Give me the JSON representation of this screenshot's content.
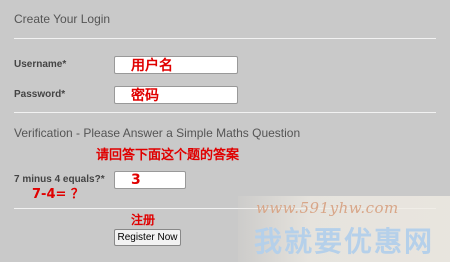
{
  "form": {
    "title": "Create Your Login",
    "username_label": "Username*",
    "password_label": "Password*",
    "verification_title": "Verification - Please Answer a Simple Maths Question",
    "question_label": "7 minus 4 equals?*",
    "register_label": "Register Now"
  },
  "fields": {
    "username_value": "用户名",
    "password_value": "密码",
    "answer_value": "3"
  },
  "annotations": {
    "question_hint": "请回答下面这个题的答案",
    "equation": "7-4= ？",
    "register_hint": "注册"
  },
  "watermark": {
    "url": "www.591yhw.com",
    "name": "我就要优惠网"
  },
  "colors": {
    "background": "#c9c9c9",
    "annotation": "#e00000"
  }
}
